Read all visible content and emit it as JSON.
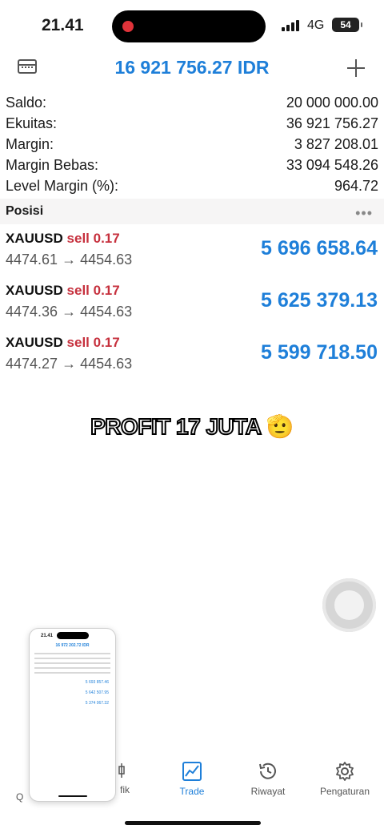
{
  "status_bar": {
    "time": "21.41",
    "network": "4G",
    "battery": "54"
  },
  "header": {
    "title": "16 921 756.27 IDR"
  },
  "summary": [
    {
      "label": "Saldo:",
      "value": "20 000 000.00"
    },
    {
      "label": "Ekuitas:",
      "value": "36 921 756.27"
    },
    {
      "label": "Margin:",
      "value": "3 827 208.01"
    },
    {
      "label": "Margin Bebas:",
      "value": "33 094 548.26"
    },
    {
      "label": "Level Margin (%):",
      "value": "964.72"
    }
  ],
  "positions_section": {
    "title": "Posisi",
    "more": "•••"
  },
  "positions": [
    {
      "symbol": "XAUUSD",
      "side": "sell 0.17",
      "prices": "4474.61 → 4454.63",
      "profit": "5 696 658.64"
    },
    {
      "symbol": "XAUUSD",
      "side": "sell 0.17",
      "prices": "4474.36 → 4454.63",
      "profit": "5 625 379.13"
    },
    {
      "symbol": "XAUUSD",
      "side": "sell 0.17",
      "prices": "4474.27 → 4454.63",
      "profit": "5 599 718.50"
    }
  ],
  "caption": {
    "text": "PROFIT 17 JUTA",
    "emoji": "🫡"
  },
  "pip": {
    "time": "21.41",
    "title": "16 972 202.72 IDR",
    "values": [
      "5 693 857.46",
      "5 642 507.95",
      "5 374 067.32"
    ]
  },
  "tabs": [
    {
      "label": "Q",
      "icon": "quotes-icon"
    },
    {
      "label": "fik",
      "icon": "chart-icon"
    },
    {
      "label": "Trade",
      "icon": "trade-icon"
    },
    {
      "label": "Riwayat",
      "icon": "history-icon"
    },
    {
      "label": "Pengaturan",
      "icon": "gear-icon"
    }
  ],
  "colors": {
    "accent": "#1e7fd9",
    "sell": "#c6303d"
  }
}
